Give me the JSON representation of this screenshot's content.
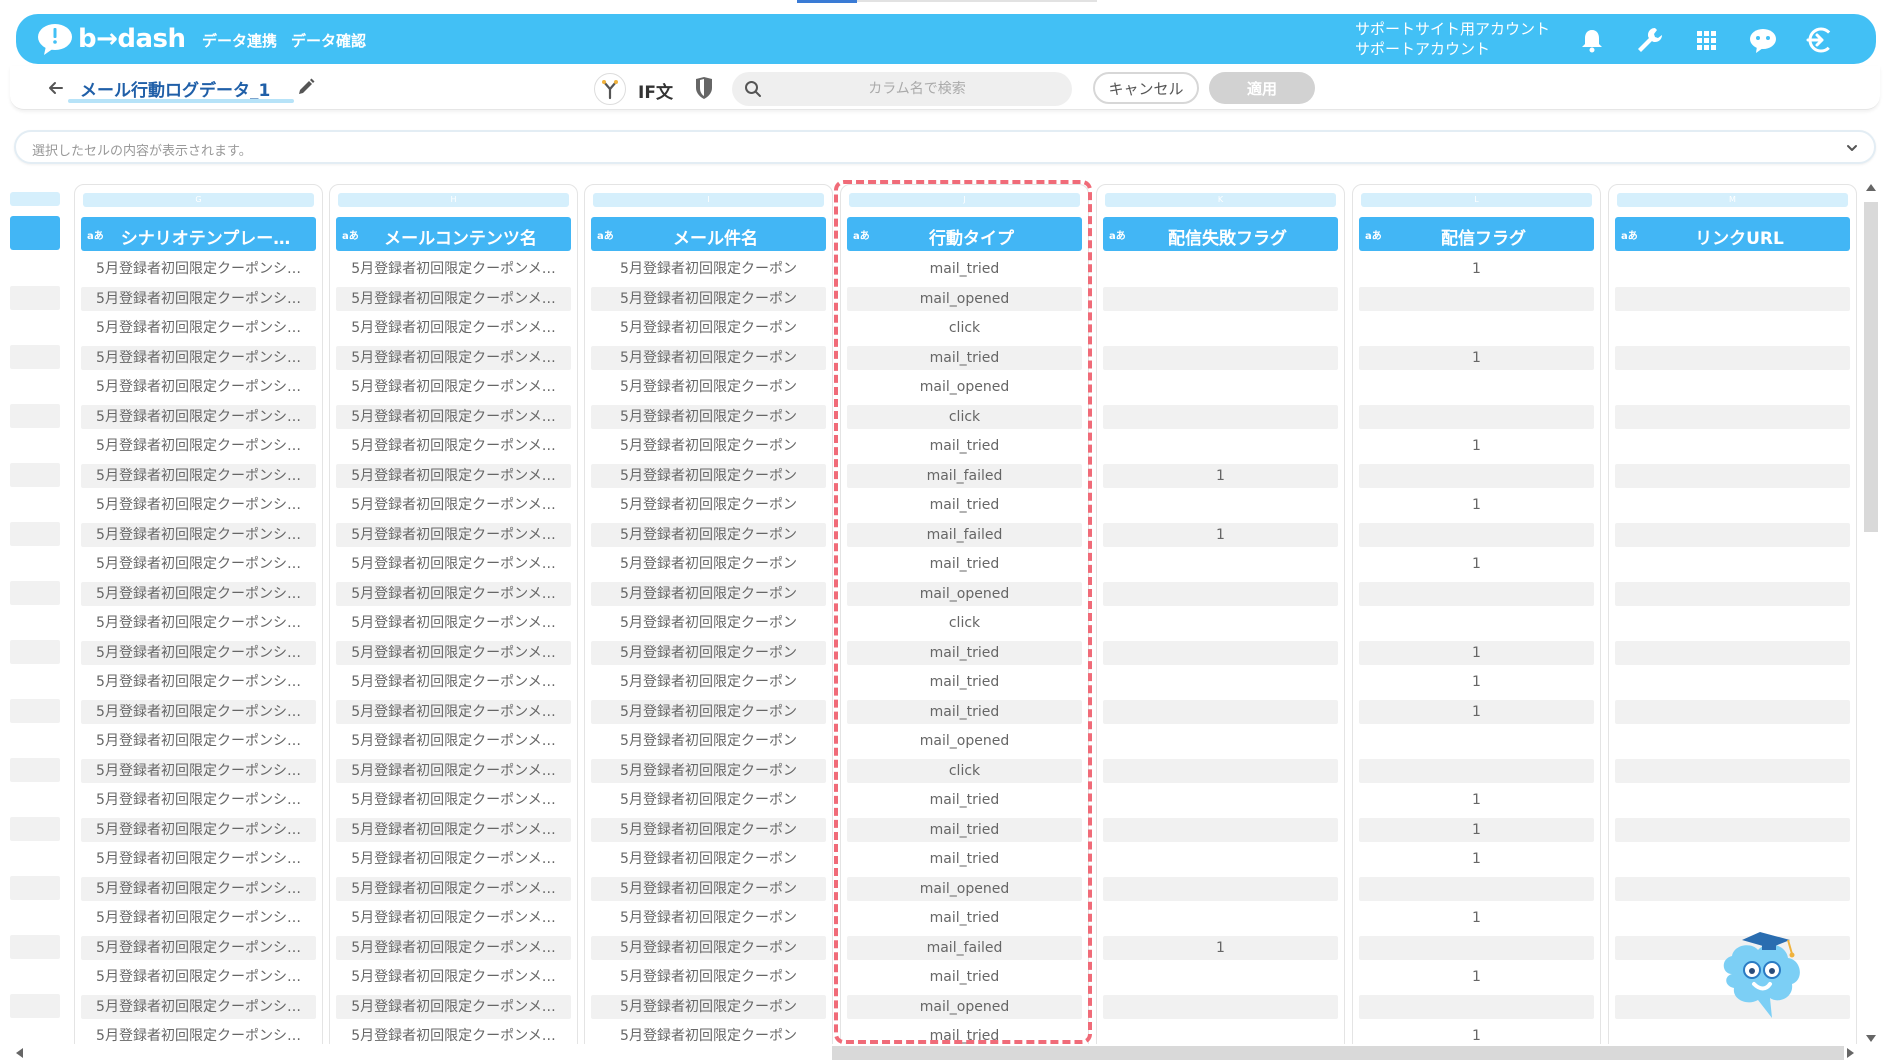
{
  "header": {
    "logo_text": "b→dash",
    "nav": [
      "データ連携",
      "データ確認"
    ],
    "account_line1": "サポートサイト用アカウント",
    "account_line2": "サポートアカウント",
    "icons": [
      "bell-icon",
      "wrench-icon",
      "apps-grid-icon",
      "chat-icon",
      "logout-icon"
    ],
    "brand_color": "#42c0f5"
  },
  "toolbar": {
    "sheet_title": "メール行動ログデータ_1",
    "if_label": "IF文",
    "search_placeholder": "カラム名で検索",
    "cancel_label": "キャンセル",
    "apply_label": "適用"
  },
  "preview": {
    "placeholder": "選択したセルの内容が表示されます。"
  },
  "grid": {
    "type_badge": "aあ",
    "columns": [
      {
        "letter": "G",
        "name": "シナリオテンプレー…"
      },
      {
        "letter": "H",
        "name": "メールコンテンツ名"
      },
      {
        "letter": "I",
        "name": "メール件名"
      },
      {
        "letter": "J",
        "name": "行動タイプ"
      },
      {
        "letter": "K",
        "name": "配信失敗フラグ"
      },
      {
        "letter": "L",
        "name": "配信フラグ"
      },
      {
        "letter": "M",
        "name": "リンクURL"
      }
    ],
    "text_g": "5月登録者初回限定クーポンシ…",
    "text_h": "5月登録者初回限定クーポンメ…",
    "text_i": "5月登録者初回限定クーポン",
    "action_types": [
      "mail_tried",
      "mail_opened",
      "click",
      "mail_tried",
      "mail_opened",
      "click",
      "mail_tried",
      "mail_failed",
      "mail_tried",
      "mail_failed",
      "mail_tried",
      "mail_opened",
      "click",
      "mail_tried",
      "mail_tried",
      "mail_tried",
      "mail_opened",
      "click",
      "mail_tried",
      "mail_tried",
      "mail_tried",
      "mail_opened",
      "mail_tried",
      "mail_failed",
      "mail_tried",
      "mail_opened",
      "mail_tried"
    ],
    "fail_flags": [
      "",
      "",
      "",
      "",
      "",
      "",
      "",
      "1",
      "",
      "1",
      "",
      "",
      "",
      "",
      "",
      "",
      "",
      "",
      "",
      "",
      "",
      "",
      "",
      "1",
      "",
      "",
      ""
    ],
    "deliver_flags": [
      "1",
      "",
      "",
      "1",
      "",
      "",
      "1",
      "",
      "1",
      "",
      "1",
      "",
      "",
      "1",
      "1",
      "1",
      "",
      "",
      "1",
      "1",
      "1",
      "",
      "1",
      "",
      "1",
      "",
      "1"
    ],
    "highlight_color": "#f06b78"
  }
}
